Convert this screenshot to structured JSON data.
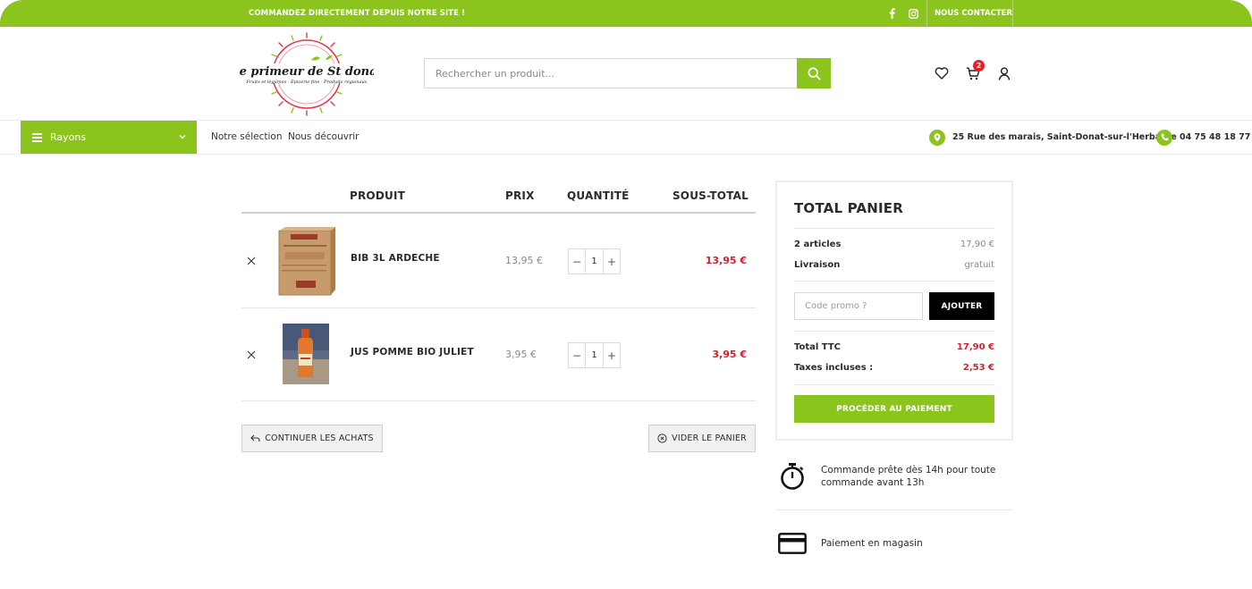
{
  "topbar": {
    "promo": "COMMANDEZ DIRECTEMENT DEPUIS NOTRE SITE !",
    "contact": "NOUS CONTACTER",
    "social": [
      "facebook-icon",
      "instagram-icon"
    ]
  },
  "brand": {
    "logo_title": "Le primeur de St donat",
    "logo_tagline": "Fruits et légumes - Épicerie fine - Produits régionaux"
  },
  "search": {
    "placeholder": "Rechercher un produit..."
  },
  "header_icons": {
    "cart_count": "2"
  },
  "nav": {
    "rayons": "Rayons",
    "links": [
      "Notre sélection",
      "Nous découvrir"
    ],
    "address": "25 Rue des marais, Saint-Donat-sur-l'Herbasse",
    "phone": "04 75 48 18 77"
  },
  "cart": {
    "headers": {
      "product": "PRODUIT",
      "price": "PRIX",
      "quantity": "QUANTITÉ",
      "subtotal": "SOUS-TOTAL"
    },
    "items": [
      {
        "name": "BIB 3L ARDECHE",
        "price": "13,95 €",
        "qty": "1",
        "subtotal": "13,95 €"
      },
      {
        "name": "JUS POMME BIO JULIET",
        "price": "3,95 €",
        "qty": "1",
        "subtotal": "3,95 €"
      }
    ],
    "continue_label": "CONTINUER LES ACHATS",
    "empty_label": "VIDER LE PANIER"
  },
  "totals": {
    "title": "TOTAL PANIER",
    "articles_label": "2 articles",
    "articles_value": "17,90 €",
    "shipping_label": "Livraison",
    "shipping_value": "gratuit",
    "promo_placeholder": "Code promo ?",
    "add_label": "AJOUTER",
    "ttc_label": "Total TTC",
    "ttc_value": "17,90 €",
    "tax_label": "Taxes incluses :",
    "tax_value": "2,53 €",
    "pay_label": "PROCÉDER AU PAIEMENT"
  },
  "features": [
    {
      "icon": "stopwatch-icon",
      "line1": "Commande prête dès 14h pour toute",
      "line2": "commande avant 13h"
    },
    {
      "icon": "credit-card-icon",
      "text": "Paiement en magasin"
    }
  ],
  "colors": {
    "brand_green": "#8cc41e",
    "price_red": "#d31f2b",
    "badge_red": "#e2202b"
  }
}
